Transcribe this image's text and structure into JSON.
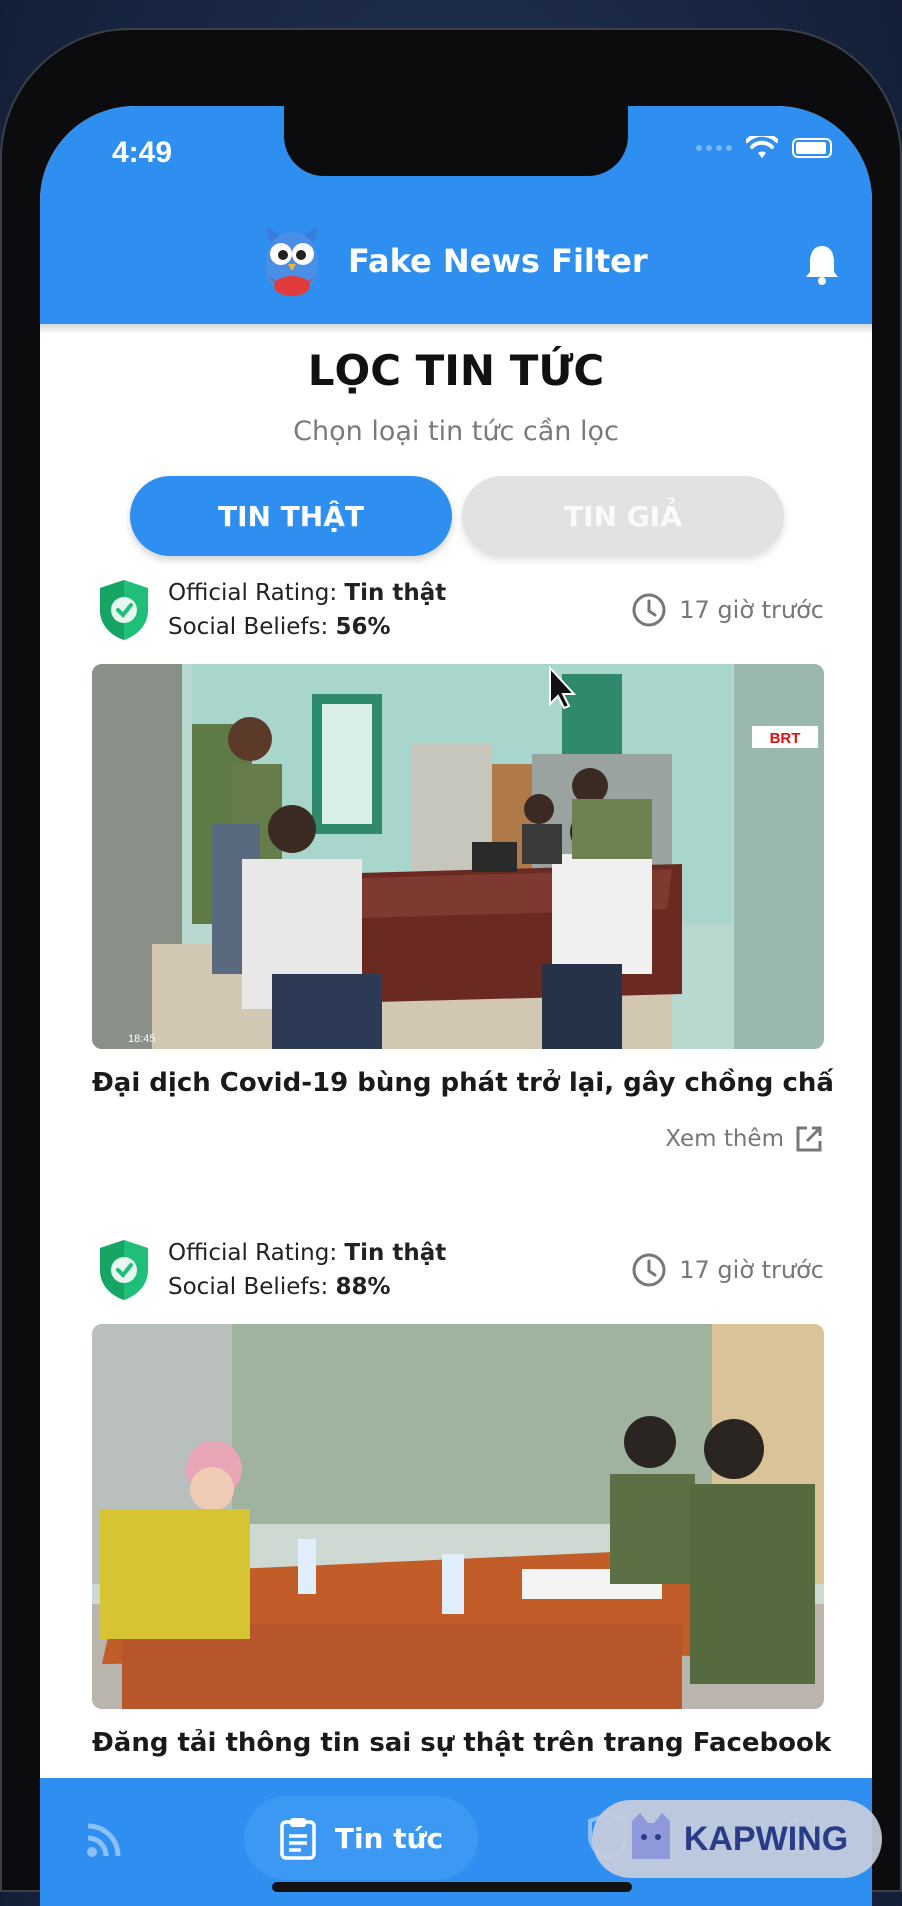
{
  "status_bar": {
    "time": "4:49"
  },
  "header": {
    "app_title": "Fake News Filter"
  },
  "page": {
    "title": "LỌC TIN TỨC",
    "subtitle": "Chọn loại tin tức cần lọc",
    "segments": [
      {
        "label": "TIN THẬT",
        "active": true
      },
      {
        "label": "TIN GIẢ",
        "active": false
      }
    ]
  },
  "articles": [
    {
      "rating_label": "Official Rating:",
      "rating_value": "Tin thật",
      "beliefs_label": "Social Beliefs:",
      "beliefs_value": "56%",
      "time_ago": "17 giờ trước",
      "headline": "Đại dịch Covid-19 bùng phát trở lại, gây chồng chấ",
      "more_label": "Xem thêm",
      "image_timestamp": "18:45",
      "image_channel": "BRT"
    },
    {
      "rating_label": "Official Rating:",
      "rating_value": "Tin thật",
      "beliefs_label": "Social Beliefs:",
      "beliefs_value": "88%",
      "time_ago": "17 giờ trước",
      "headline": "Đăng tải thông tin sai sự thật trên trang Facebook"
    }
  ],
  "bottom_nav": {
    "active_label": "Tin tức",
    "items": [
      "feed-icon",
      "news-icon",
      "shield-icon",
      "settings-icon"
    ]
  },
  "watermark": {
    "text": "KAPWING"
  },
  "colors": {
    "primary": "#2e8ff0",
    "shield_green": "#1fbf7a"
  }
}
